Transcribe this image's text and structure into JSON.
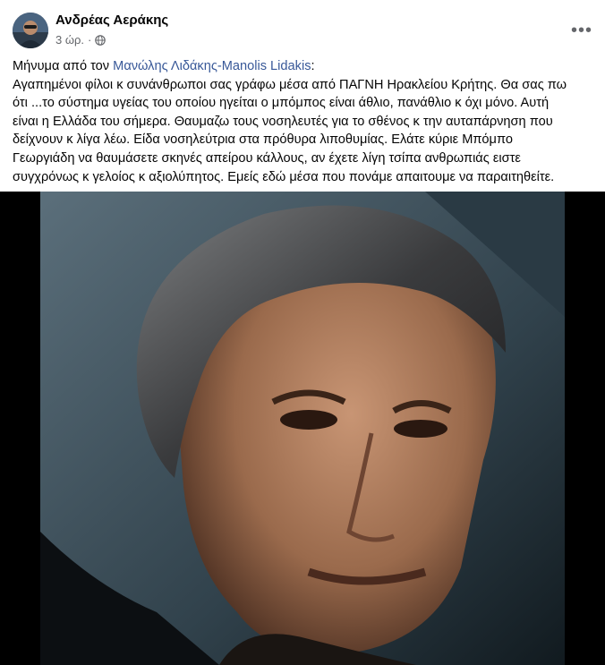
{
  "post": {
    "author": "Ανδρέας Αεράκης",
    "time": "3 ώρ.",
    "separator": "·",
    "privacy_icon": "globe-icon",
    "more_icon": "more-options-icon",
    "more_label": "•••",
    "message_prefix": "Μήνυμα από τον ",
    "mention": "Μανώλης Λιδάκης-Manolis Lidakis",
    "mention_suffix": ":",
    "body_lines": [
      "Αγαπημένοι φίλοι κ συνάνθρωποι σας γράφω μέσα από ΠΑΓΝΗ Ηρακλείου Κρήτης. Θα σας πω",
      "ότι ...το σύστημα υγείας του οποίου ηγείται ο μπόμπος είναι άθλιο, πανάθλιο κ όχι μόνο. Αυτή",
      "είναι η Ελλάδα του σήμερα. Θαυμαζω τους νοσηλευτές για το σθένος κ την αυταπάρνηση που",
      "δείχνουν κ λίγα λέω. Είδα νοσηλεύτρια στα πρόθυρα λιποθυμίας. Ελάτε κύριε Μπόμπο",
      "Γεωργιάδη να θαυμάσετε σκηνές απείρου κάλλους, αν έχετε λίγη τσίπα ανθρωπιάς ειστε",
      "συγχρόνως κ γελοίος κ αξιολύπητος. Εμείς εδώ μέσα που πονάμε απαιτουμε να παραιτηθείτε."
    ]
  },
  "colors": {
    "link": "#385898",
    "secondary_text": "#65676b",
    "photo_background": "#000000"
  }
}
